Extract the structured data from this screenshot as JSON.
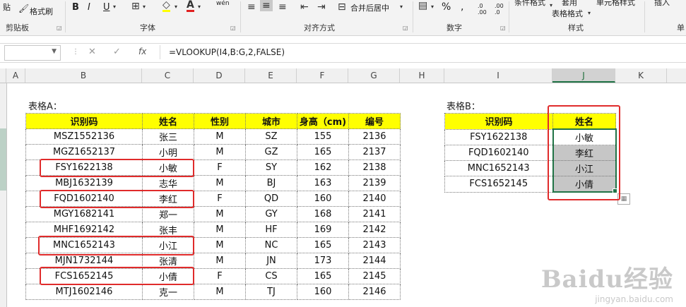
{
  "ribbon": {
    "paste_label": "贴",
    "format_painter": "格式刷",
    "groups": {
      "clipboard": "剪贴板",
      "font": "字体",
      "alignment": "对齐方式",
      "number": "数字",
      "styles": "样式",
      "cells": "单"
    },
    "bold": "B",
    "italic": "I",
    "underline": "U",
    "merge_center": "合并后居中",
    "percent": "%",
    "comma": ",",
    "cond_format": "条件格式",
    "table_format_1": "套用",
    "table_format_2": "表格格式",
    "cell_styles": "单元格样式",
    "insert": "插入",
    "wen": "wén",
    "dec_inc": ".0 .00",
    "dec_dec": ".00 .0"
  },
  "formula_bar": {
    "name_box": "",
    "fx": "fx",
    "formula": "=VLOOKUP(I4,B:G,2,FALSE)"
  },
  "columns": [
    "A",
    "B",
    "C",
    "D",
    "E",
    "F",
    "G",
    "H",
    "I",
    "J",
    "K"
  ],
  "selected_column": "J",
  "table_a": {
    "title": "表格A：",
    "headers": [
      "识别码",
      "姓名",
      "性别",
      "城市",
      "身高（cm)",
      "编号"
    ],
    "rows": [
      [
        "MSZ1552136",
        "张三",
        "M",
        "SZ",
        "155",
        "2136"
      ],
      [
        "MGZ1652137",
        "小明",
        "M",
        "GZ",
        "165",
        "2137"
      ],
      [
        "FSY1622138",
        "小敏",
        "F",
        "SY",
        "162",
        "2138"
      ],
      [
        "MBJ1632139",
        "志华",
        "M",
        "BJ",
        "163",
        "2139"
      ],
      [
        "FQD1602140",
        "李红",
        "F",
        "QD",
        "160",
        "2140"
      ],
      [
        "MGY1682141",
        "郑一",
        "M",
        "GY",
        "168",
        "2141"
      ],
      [
        "MHF1692142",
        "张丰",
        "M",
        "HF",
        "169",
        "2142"
      ],
      [
        "MNC1652143",
        "小江",
        "M",
        "NC",
        "165",
        "2143"
      ],
      [
        "MJN1732144",
        "张清",
        "M",
        "JN",
        "173",
        "2144"
      ],
      [
        "FCS1652145",
        "小倩",
        "F",
        "CS",
        "165",
        "2145"
      ],
      [
        "MTJ1602146",
        "克一",
        "M",
        "TJ",
        "160",
        "2146"
      ]
    ]
  },
  "table_b": {
    "title": "表格B：",
    "headers": [
      "识别码",
      "姓名"
    ],
    "rows": [
      [
        "FSY1622138",
        "小敏"
      ],
      [
        "FQD1602140",
        "李红"
      ],
      [
        "MNC1652143",
        "小江"
      ],
      [
        "FCS1652145",
        "小倩"
      ]
    ]
  },
  "colors": {
    "header_fill": "#ffff00",
    "annotation_red": "#e02b2b",
    "selection_fill": "#c6c6c6",
    "excel_green": "#217346"
  },
  "watermark": {
    "brand": "Baidu经验",
    "url": "jingyan.baidu.com"
  }
}
